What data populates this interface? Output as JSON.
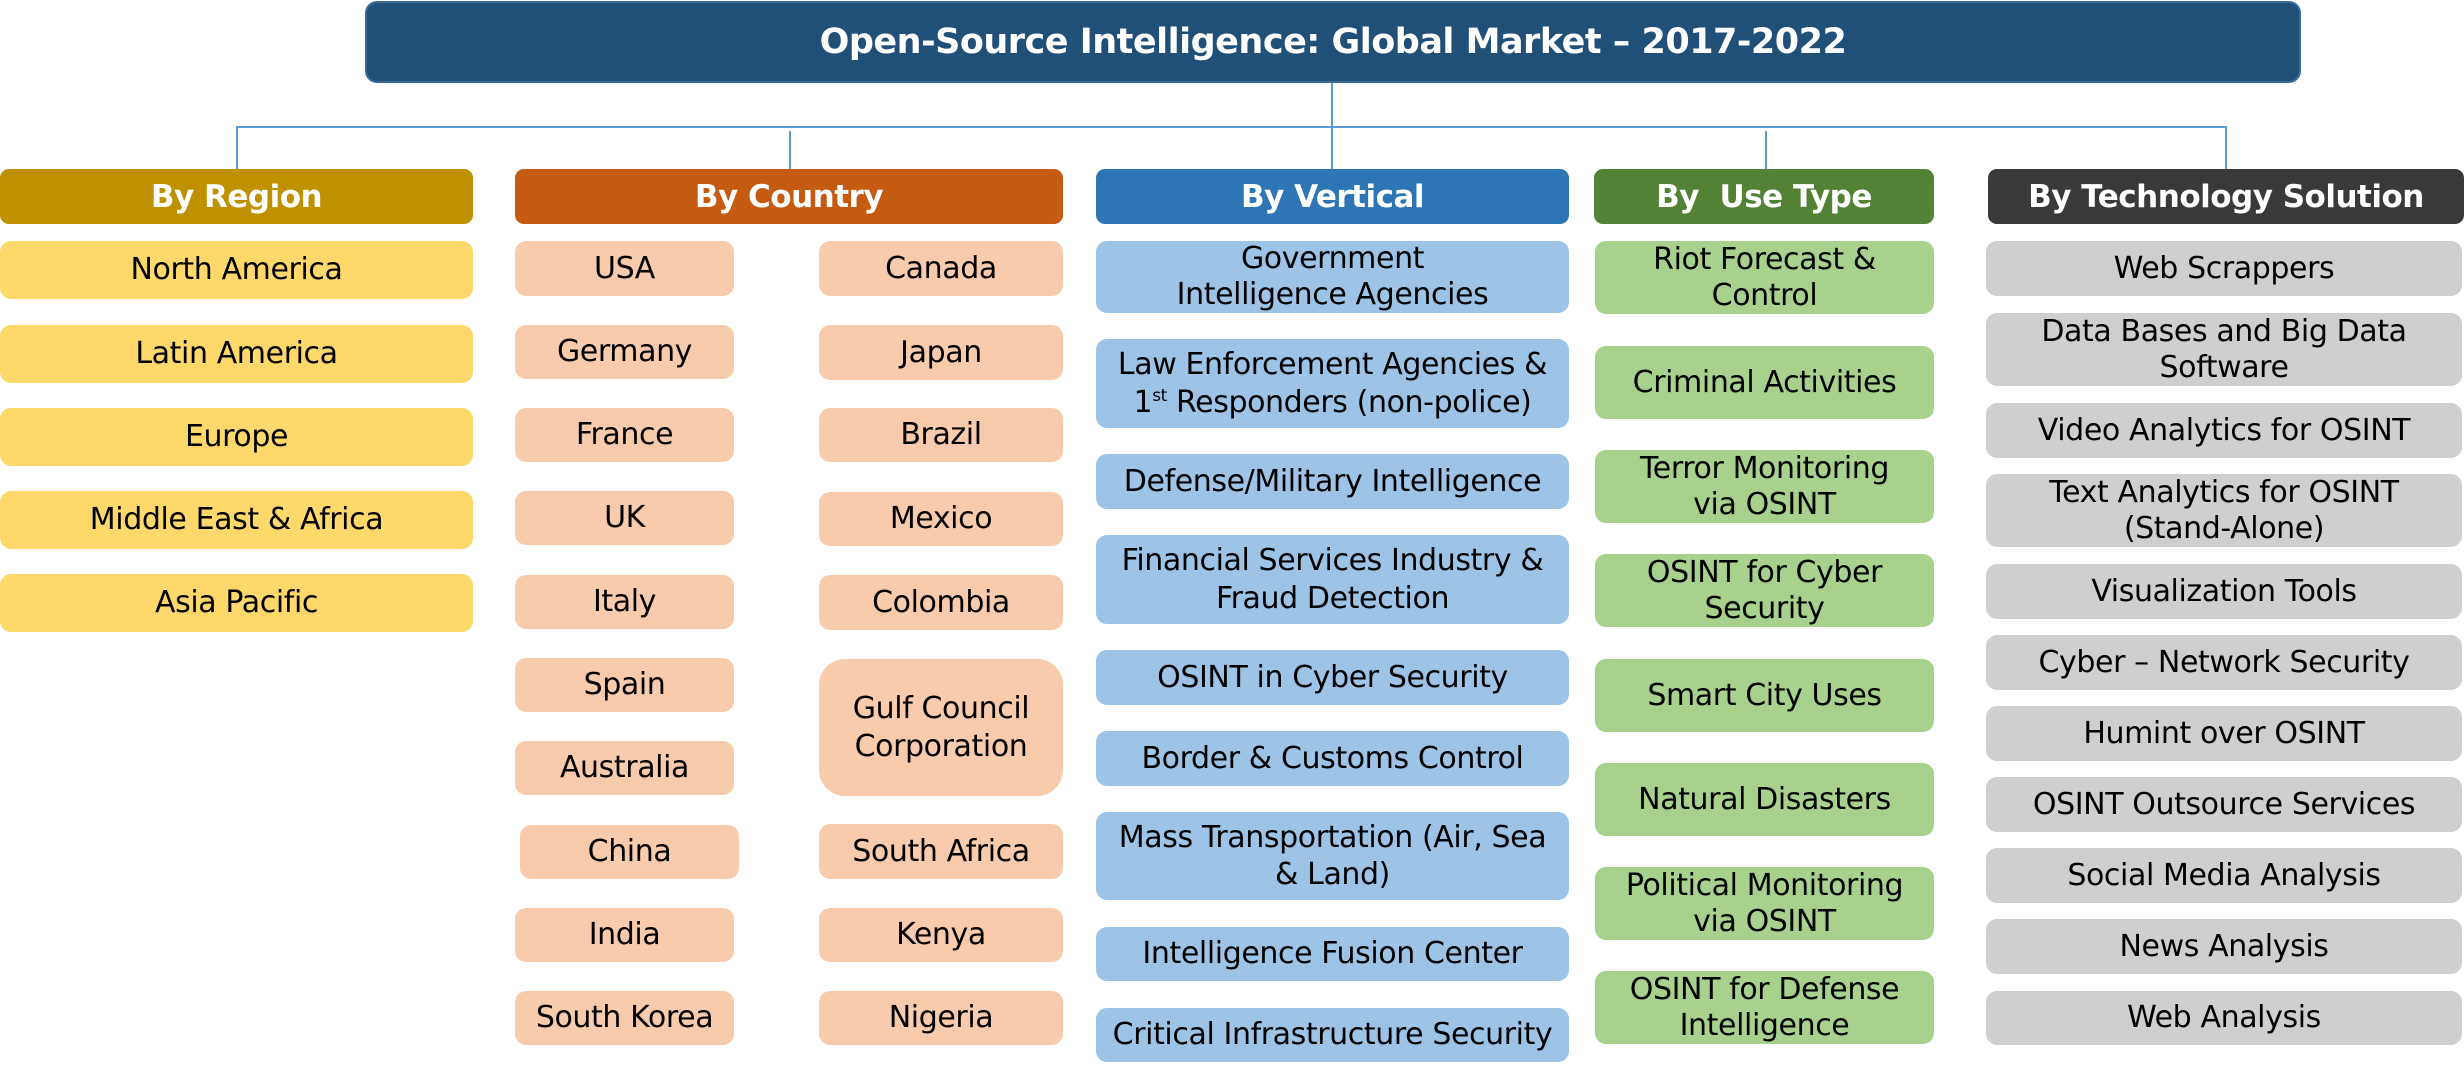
{
  "title": "Open-Source Intelligence: Global Market – 2017-2022",
  "colors": {
    "title_bg": "#204f78",
    "connector": "#5b9bd5",
    "region_header": "#bf9000",
    "region_item": "#fed86a",
    "country_header": "#c55a11",
    "country_item": "#f7cbac",
    "vertical_header": "#2e75b6",
    "vertical_item": "#9dc3e6",
    "usetype_header": "#538135",
    "usetype_item": "#a9d18e",
    "tech_header": "#3a3838",
    "tech_item": "#d0cece"
  },
  "region": {
    "header": "By Region",
    "items": [
      "North America",
      "Latin America",
      "Europe",
      "Middle East & Africa",
      "Asia Pacific"
    ]
  },
  "country": {
    "header": "By Country",
    "left": [
      "USA",
      "Germany",
      "France",
      "UK",
      "Italy",
      "Spain",
      "Australia",
      "China",
      "India",
      "South Korea"
    ],
    "right": [
      "Canada",
      "Japan",
      "Brazil",
      "Mexico",
      "Colombia",
      "Gulf Council Corporation",
      "South Africa",
      "Kenya",
      "Nigeria"
    ]
  },
  "vertical": {
    "header": "By Vertical",
    "items": [
      "Government Intelligence Agencies",
      "Law Enforcement Agencies &",
      "Defense/Military Intelligence",
      "Financial Services Industry & Fraud Detection",
      "OSINT in Cyber Security",
      "Border & Customs Control",
      "Mass Transportation (Air, Sea & Land)",
      "Intelligence Fusion Center",
      "Critical Infrastructure Security"
    ],
    "law_line2_num": "1",
    "law_line2_sup": "st",
    "law_line2_rest": " Responders (non-police)"
  },
  "usetype": {
    "header": "By  Use Type",
    "items": [
      "Riot Forecast & Control",
      "Criminal Activities",
      "Terror Monitoring via OSINT",
      "OSINT for Cyber Security",
      "Smart City Uses",
      "Natural Disasters",
      "Political Monitoring via OSINT",
      "OSINT for Defense Intelligence"
    ]
  },
  "tech": {
    "header": "By Technology Solution",
    "items": [
      "Web Scrappers",
      "Data Bases and Big Data Software",
      "Video Analytics for OSINT",
      "Text Analytics for OSINT (Stand-Alone)",
      "Visualization Tools",
      "Cyber – Network Security",
      "Humint over OSINT",
      "OSINT Outsource Services",
      "Social Media Analysis",
      "News Analysis",
      "Web Analysis"
    ]
  }
}
